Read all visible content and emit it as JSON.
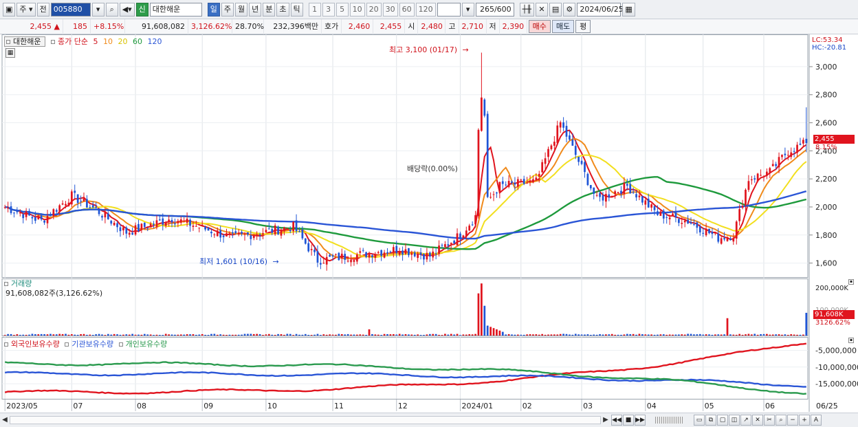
{
  "toolbar": {
    "code": "005880",
    "mode1": "주",
    "mode2": "전",
    "credit": "신",
    "stock_name": "대한해운",
    "periods": [
      "일",
      "주",
      "월",
      "년",
      "분",
      "초",
      "틱"
    ],
    "numbers": [
      "1",
      "3",
      "5",
      "10",
      "20",
      "30",
      "60",
      "120"
    ],
    "count": "265",
    "total": "/600",
    "date": "2024/06/25"
  },
  "quote": {
    "price": "2,455",
    "change": "185",
    "change_pct": "+8.15%",
    "volume": "91,608,082",
    "vol_pct": "3,126.62%",
    "turnover": "28.70%",
    "amount": "232,396백만",
    "bid_label": "호가",
    "bid1": "2,460",
    "bid2": "2,455",
    "open_label": "시",
    "open": "2,480",
    "high_label": "고",
    "high": "2,710",
    "low_label": "저",
    "low": "2,390",
    "buy": "매수",
    "sell": "매도",
    "even": "평"
  },
  "legend": {
    "name": "대한해운",
    "ma_label": "종가 단순",
    "ma5": "5",
    "ma10": "10",
    "ma20": "20",
    "ma60": "60",
    "ma120": "120",
    "volume_label": "거래량",
    "volume_value": "91,608,082주(3,126.62%)",
    "foreign": "외국인보유수량",
    "inst": "기관보유수량",
    "indiv": "개인보유수량"
  },
  "annotations": {
    "high": "최고 3,100 (01/17)",
    "low": "최저 1,601 (10/16)",
    "dividend": "배당락(0.00%)"
  },
  "right_axis": {
    "lc": "LC:53.34",
    "hc": "HC:-20.81",
    "price_ticks": [
      "3,000",
      "2,800",
      "2,600",
      "2,400",
      "2,200",
      "2,000",
      "1,800",
      "1,600"
    ],
    "price_badge": "2,455",
    "price_badge_pct": "8.15%",
    "vol_tick": "200,000K",
    "vol_tick2": "100,000K",
    "vol_badge": "91,608K",
    "vol_badge_pct": "3126.62%",
    "hold_ticks": [
      "-5,000,000",
      "-10,000,000",
      "-15,000,000"
    ]
  },
  "x_axis": {
    "labels": [
      "2023/05",
      "07",
      "08",
      "09",
      "10",
      "11",
      "12",
      "2024/01",
      "02",
      "03",
      "04",
      "05",
      "06"
    ],
    "end_label": "06/25"
  },
  "colors": {
    "ma5": "#e0141e",
    "ma10": "#f08a1a",
    "ma20": "#f2df1e",
    "ma60": "#1e9a3c",
    "ma120": "#2a55d6",
    "up": "#e0141e",
    "down": "#1f55d6",
    "foreign": "#e0141e",
    "inst": "#2a55d6",
    "indiv": "#2a9a4e"
  },
  "chart_data": [
    {
      "type": "candlestick",
      "title": "대한해운",
      "x_range": [
        "2023/05",
        "2024/06/25"
      ],
      "ylim": [
        1550,
        3100
      ],
      "y_ticks": [
        1600,
        1800,
        2000,
        2200,
        2400,
        2600,
        2800,
        3000
      ],
      "key_points": [
        {
          "date": "2023/05",
          "close": 2000
        },
        {
          "date": "2023/06",
          "close": 1900
        },
        {
          "date": "2023/06",
          "close": 2080
        },
        {
          "date": "2023/07",
          "close": 1980
        },
        {
          "date": "2023/07",
          "close": 1820
        },
        {
          "date": "2023/08",
          "close": 1920
        },
        {
          "date": "2023/09",
          "close": 1780
        },
        {
          "date": "2023/10",
          "close": 1860
        },
        {
          "date": "2023/10/16",
          "close": 1620
        },
        {
          "date": "2023/11",
          "close": 1700
        },
        {
          "date": "2023/11",
          "close": 1650
        },
        {
          "date": "2023/12",
          "close": 1800
        },
        {
          "date": "2023/12",
          "close": 2150
        },
        {
          "date": "2024/01",
          "close": 2180
        },
        {
          "date": "2024/01/17",
          "close": 2600
        },
        {
          "date": "2024/02",
          "close": 2050
        },
        {
          "date": "2024/02",
          "close": 2150
        },
        {
          "date": "2024/03",
          "close": 1950
        },
        {
          "date": "2024/04",
          "close": 1900
        },
        {
          "date": "2024/04",
          "close": 1780
        },
        {
          "date": "2024/05",
          "close": 1800
        },
        {
          "date": "2024/05",
          "close": 2200
        },
        {
          "date": "2024/06",
          "close": 2250
        },
        {
          "date": "2024/06",
          "close": 2400
        },
        {
          "date": "2024/06/25",
          "close": 2455
        }
      ],
      "annotations": [
        {
          "label": "최고 3,100 (01/17)",
          "value": 3100
        },
        {
          "label": "최저 1,601 (10/16)",
          "value": 1601
        }
      ],
      "series": [
        {
          "name": "5",
          "ma": 5
        },
        {
          "name": "10",
          "ma": 10
        },
        {
          "name": "20",
          "ma": 20
        },
        {
          "name": "60",
          "ma": 60
        },
        {
          "name": "120",
          "ma": 120
        }
      ]
    },
    {
      "type": "bar",
      "title": "거래량",
      "ylabel": "",
      "y_ticks": [
        "200,000K",
        "100,000K"
      ],
      "last_value": 91608082
    },
    {
      "type": "line",
      "title": "",
      "series": [
        {
          "name": "외국인보유수량",
          "start": -17500000,
          "end": -2500000
        },
        {
          "name": "기관보유수량",
          "start": -12000000,
          "end": -15500000
        },
        {
          "name": "개인보유수량",
          "start": -9000000,
          "end": -18000000
        }
      ],
      "y_ticks": [
        -5000000,
        -10000000,
        -15000000
      ]
    }
  ]
}
